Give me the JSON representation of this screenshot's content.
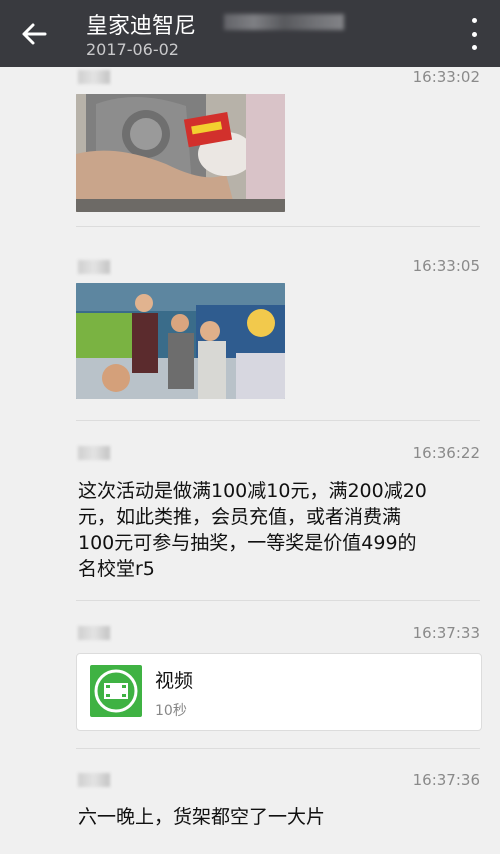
{
  "header": {
    "title": "皇家迪智尼",
    "date": "2017-06-02",
    "back_icon": "back-arrow-icon",
    "more_icon": "more-vertical-icon"
  },
  "messages": [
    {
      "type": "image",
      "time": "16:33:02"
    },
    {
      "type": "image",
      "time": "16:33:05"
    },
    {
      "type": "text",
      "time": "16:36:22",
      "lines": [
        "这次活动是做满100减10元，满200减20",
        "元，如此类推，会员充值，或者消费满",
        "100元可参与抽奖，一等奖是价值499的",
        "名校堂r5"
      ]
    },
    {
      "type": "video",
      "time": "16:37:33",
      "label": "视频",
      "duration": "10秒",
      "icon": "video-file-icon"
    },
    {
      "type": "text",
      "time": "16:37:36",
      "lines": [
        "六一晚上，货架都空了一大片"
      ]
    }
  ],
  "colors": {
    "header_bg": "#393a3f",
    "page_bg": "#f0f0f0",
    "video_icon_bg": "#3fb243"
  }
}
